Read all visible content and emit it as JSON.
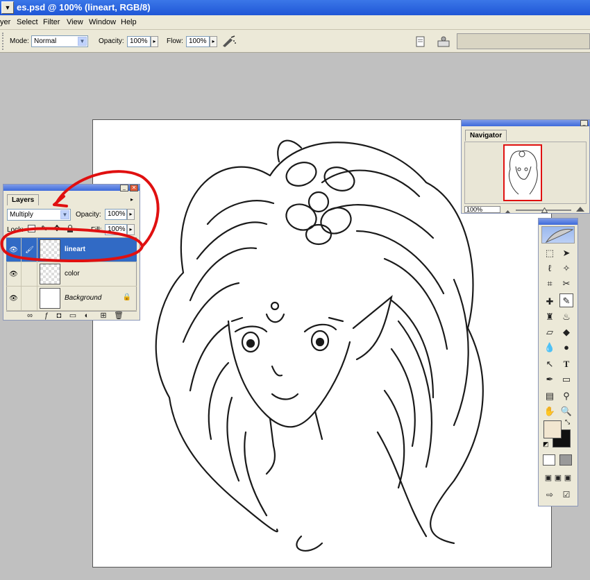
{
  "titlebar": {
    "title": "es.psd @ 100% (lineart, RGB/8)"
  },
  "menu": {
    "items": [
      "yer",
      "Select",
      "Filter",
      "View",
      "Window",
      "Help"
    ]
  },
  "options": {
    "mode_label": "Mode:",
    "mode_value": "Normal",
    "opacity_label": "Opacity:",
    "opacity_value": "100%",
    "flow_label": "Flow:",
    "flow_value": "100%"
  },
  "layers_panel": {
    "tab": "Layers",
    "blend_mode": "Multiply",
    "opacity_label": "Opacity:",
    "opacity_value": "100%",
    "lock_label": "Lock:",
    "fill_label": "Fill:",
    "fill_value": "100%",
    "layers": [
      {
        "name": "lineart",
        "selected": true
      },
      {
        "name": "color",
        "selected": false
      },
      {
        "name": "Background",
        "selected": false
      }
    ]
  },
  "navigator_panel": {
    "tab": "Navigator",
    "zoom": "100%"
  },
  "colors": {
    "foreground": "#f2e6d0",
    "background": "#111111",
    "annotation": "#e01010"
  },
  "icons": [
    "brush-icon",
    "marquee-icon",
    "move-icon",
    "lasso-icon",
    "wand-icon",
    "crop-icon",
    "slice-icon",
    "heal-icon",
    "stamp-icon",
    "history-brush-icon",
    "eraser-icon",
    "bucket-icon",
    "blur-icon",
    "dodge-icon",
    "select-arrow-icon",
    "type-icon",
    "pen-icon",
    "shape-icon",
    "notes-icon",
    "eyedropper-icon",
    "hand-icon",
    "zoom-icon"
  ],
  "toolbox": {
    "type_glyph": "T"
  }
}
